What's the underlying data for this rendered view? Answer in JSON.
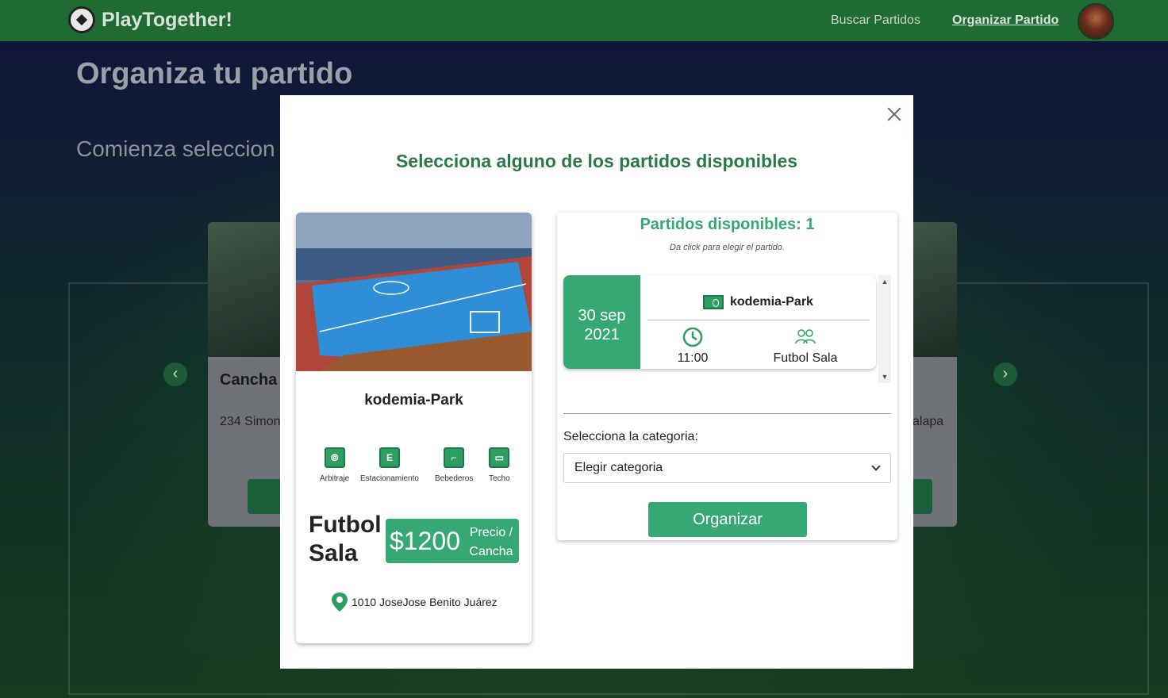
{
  "navbar": {
    "brand": "PlayTogether!",
    "links": [
      "Buscar Partidos",
      "Organizar Partido"
    ]
  },
  "page": {
    "title": "Organiza tu partido",
    "subtitle": "Comienza seleccion"
  },
  "background_cards": [
    {
      "title": "Cancha",
      "address": "234 Simon"
    },
    {
      "title": "",
      "address": "alapa"
    }
  ],
  "modal": {
    "title": "Selecciona alguno de los partidos disponibles",
    "venue": {
      "name": "kodemia-Park",
      "amenities": [
        {
          "label": "Arbitraje",
          "icon": "whistle-icon"
        },
        {
          "label": "Estacionamiento",
          "icon": "parking-icon"
        },
        {
          "label": "Bebederos",
          "icon": "water-fountain-icon"
        },
        {
          "label": "Techo",
          "icon": "roof-icon"
        }
      ],
      "sport": "Futbol Sala",
      "price": "$1200",
      "price_unit": "Precio / Cancha",
      "address": "1010 JoseJose Benito Juárez"
    },
    "matches": {
      "title": "Partidos disponibles: 1",
      "hint": "Da click para elegir el partido.",
      "items": [
        {
          "date": "30 sep 2021",
          "venue": "kodemia-Park",
          "time": "11:00",
          "type": "Futbol Sala"
        }
      ]
    },
    "category": {
      "label": "Selecciona la categoria:",
      "selected": "Elegir categoria"
    },
    "submit_label": "Organizar"
  },
  "colors": {
    "navbar": "#1f6b34",
    "accent": "#36a873",
    "title_green": "#2b7a46"
  }
}
